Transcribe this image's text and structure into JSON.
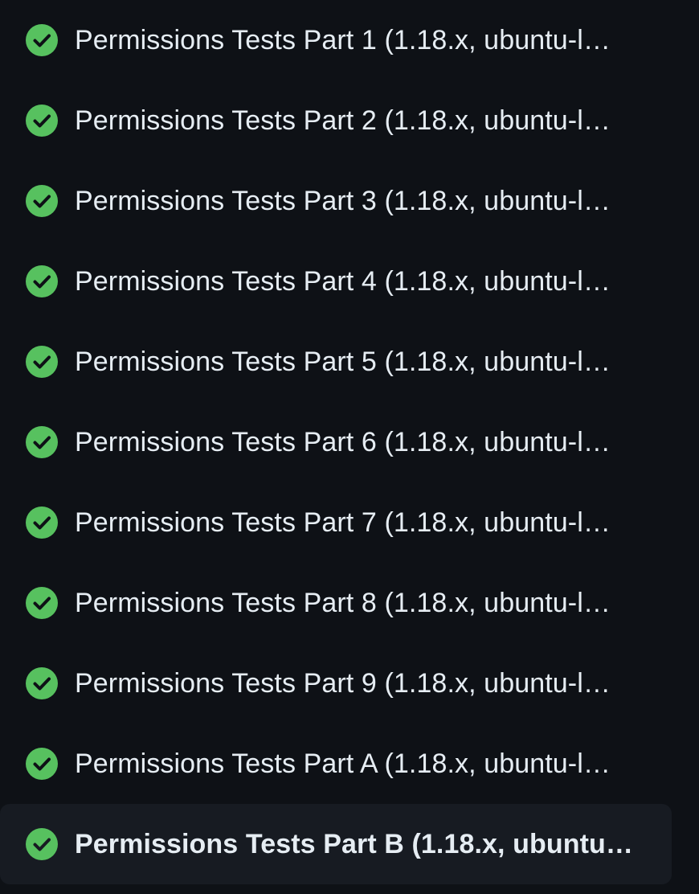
{
  "jobs": [
    {
      "label": "Permissions Tests Part 1 (1.18.x, ubuntu-l…",
      "status": "success",
      "status_icon": "check-circle-fill-icon",
      "selected": false
    },
    {
      "label": "Permissions Tests Part 2 (1.18.x, ubuntu-l…",
      "status": "success",
      "status_icon": "check-circle-fill-icon",
      "selected": false
    },
    {
      "label": "Permissions Tests Part 3 (1.18.x, ubuntu-l…",
      "status": "success",
      "status_icon": "check-circle-fill-icon",
      "selected": false
    },
    {
      "label": "Permissions Tests Part 4 (1.18.x, ubuntu-l…",
      "status": "success",
      "status_icon": "check-circle-fill-icon",
      "selected": false
    },
    {
      "label": "Permissions Tests Part 5 (1.18.x, ubuntu-l…",
      "status": "success",
      "status_icon": "check-circle-fill-icon",
      "selected": false
    },
    {
      "label": "Permissions Tests Part 6 (1.18.x, ubuntu-l…",
      "status": "success",
      "status_icon": "check-circle-fill-icon",
      "selected": false
    },
    {
      "label": "Permissions Tests Part 7 (1.18.x, ubuntu-l…",
      "status": "success",
      "status_icon": "check-circle-fill-icon",
      "selected": false
    },
    {
      "label": "Permissions Tests Part 8 (1.18.x, ubuntu-l…",
      "status": "success",
      "status_icon": "check-circle-fill-icon",
      "selected": false
    },
    {
      "label": "Permissions Tests Part 9 (1.18.x, ubuntu-l…",
      "status": "success",
      "status_icon": "check-circle-fill-icon",
      "selected": false
    },
    {
      "label": "Permissions Tests Part A (1.18.x, ubuntu-l…",
      "status": "success",
      "status_icon": "check-circle-fill-icon",
      "selected": false
    },
    {
      "label": "Permissions Tests Part B (1.18.x, ubuntu…",
      "status": "success",
      "status_icon": "check-circle-fill-icon",
      "selected": true
    }
  ],
  "colors": {
    "background": "#0e1116",
    "selected_background": "#171b22",
    "success": "#57c15f",
    "text": "#e6edf3"
  }
}
